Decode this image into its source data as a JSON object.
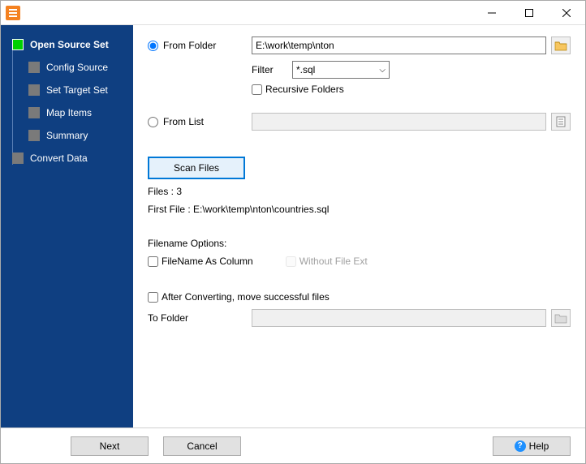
{
  "title": "",
  "sidebar": {
    "items": [
      {
        "label": "Open Source Set",
        "level": 0,
        "active": true
      },
      {
        "label": "Config Source",
        "level": 1,
        "active": false
      },
      {
        "label": "Set Target Set",
        "level": 1,
        "active": false
      },
      {
        "label": "Map Items",
        "level": 1,
        "active": false
      },
      {
        "label": "Summary",
        "level": 1,
        "active": false
      },
      {
        "label": "Convert Data",
        "level": 0,
        "active": false
      }
    ]
  },
  "main": {
    "from_folder_label": "From Folder",
    "from_folder_value": "E:\\work\\temp\\nton",
    "filter_label": "Filter",
    "filter_value": "*.sql",
    "recursive_label": "Recursive Folders",
    "from_list_label": "From List",
    "from_list_value": "",
    "scan_btn": "Scan Files",
    "files_status": "Files : 3",
    "first_file": "First File : E:\\work\\temp\\nton\\countries.sql",
    "filename_options_label": "Filename Options:",
    "filename_as_column": "FileName As Column",
    "without_ext": "Without File Ext",
    "after_convert": "After Converting, move successful files",
    "to_folder_label": "To Folder",
    "to_folder_value": ""
  },
  "footer": {
    "next": "Next",
    "cancel": "Cancel",
    "help": "Help"
  }
}
